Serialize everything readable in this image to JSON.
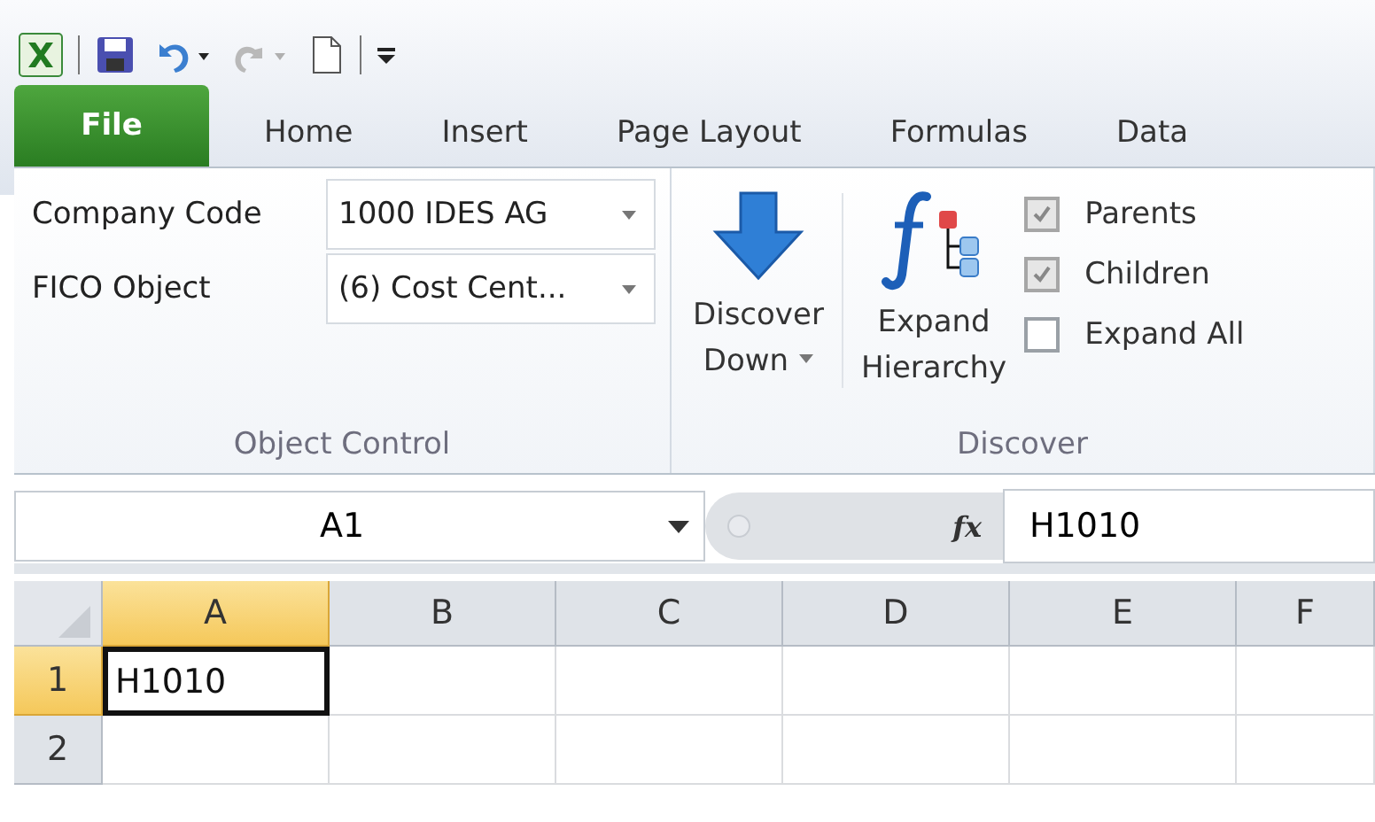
{
  "tabs": [
    {
      "label": "File",
      "kind": "file",
      "selected": false
    },
    {
      "label": "Home",
      "kind": "tab",
      "selected": false
    },
    {
      "label": "Insert",
      "kind": "tab",
      "selected": false
    },
    {
      "label": "Page Layout",
      "kind": "tab",
      "selected": false
    },
    {
      "label": "Formulas",
      "kind": "tab",
      "selected": false
    },
    {
      "label": "Data",
      "kind": "tab",
      "selected": false
    }
  ],
  "object_control": {
    "title": "Object Control",
    "fields": [
      {
        "label": "Company Code",
        "value": "1000 IDES AG"
      },
      {
        "label": "FICO Object",
        "value": "(6) Cost Cent..."
      }
    ]
  },
  "discover": {
    "title": "Discover",
    "discover_down": {
      "line_1": "Discover",
      "line_2": "Down"
    },
    "expand_hierarchy": {
      "line_1": "Expand",
      "line_2": "Hierarchy"
    },
    "options": [
      {
        "label": "Parents",
        "checked": true,
        "disabled": true
      },
      {
        "label": "Children",
        "checked": true,
        "disabled": true
      },
      {
        "label": "Expand All",
        "checked": false,
        "disabled": false
      }
    ]
  },
  "formula_bar": {
    "name_box": "A1",
    "function_symbol": "fx",
    "value": "H1010"
  },
  "sheet": {
    "columns": [
      {
        "label": "A",
        "selected": true
      },
      {
        "label": "B",
        "selected": false
      },
      {
        "label": "C",
        "selected": false
      },
      {
        "label": "D",
        "selected": false
      },
      {
        "label": "E",
        "selected": false
      },
      {
        "label": "F",
        "selected": false
      }
    ],
    "rows": [
      {
        "label": "1",
        "selected": true,
        "cells": [
          "H1010",
          "",
          "",
          "",
          "",
          ""
        ]
      },
      {
        "label": "2",
        "selected": false,
        "cells": [
          "",
          "",
          "",
          "",
          "",
          ""
        ]
      }
    ]
  }
}
